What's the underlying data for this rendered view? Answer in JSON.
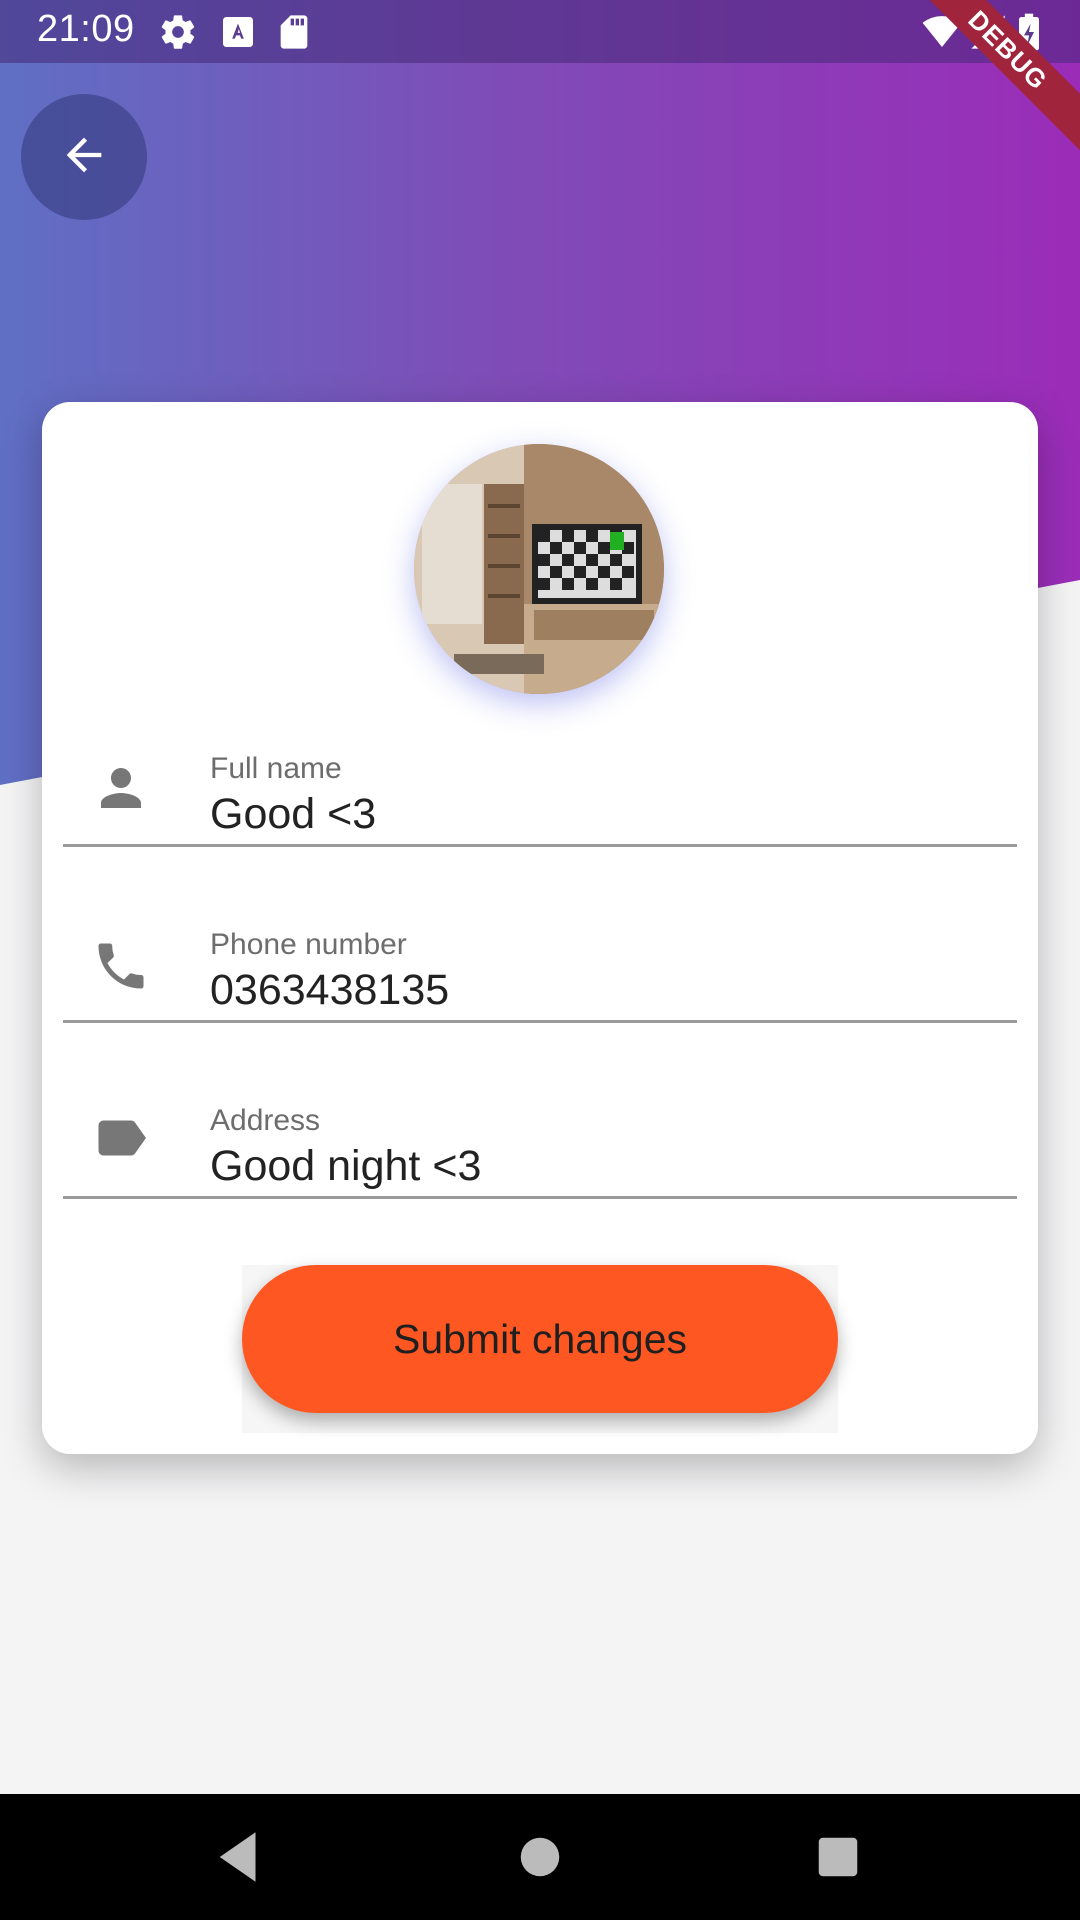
{
  "status_bar": {
    "time": "21:09",
    "left_icons": [
      "settings-icon",
      "a-keyboard-icon",
      "sd-card-icon"
    ],
    "right_icons": [
      "wifi-icon",
      "signal-icon",
      "battery-charging-icon"
    ],
    "debug_label": "DEBUG"
  },
  "header": {
    "back_icon": "arrow-back-icon",
    "gradient_colors": [
      "#5f6fc4",
      "#9b2cb8"
    ]
  },
  "profile": {
    "avatar_description": "avatar image"
  },
  "form": {
    "fields": [
      {
        "icon": "person-icon",
        "label": "Full name",
        "value": "Good <3"
      },
      {
        "icon": "phone-icon",
        "label": "Phone number",
        "value": "0363438135"
      },
      {
        "icon": "label-tag-icon",
        "label": "Address",
        "value": "Good night <3"
      }
    ],
    "submit_label": "Submit changes",
    "accent_color": "#ff5722"
  },
  "nav_bar": {
    "buttons": [
      "back-triangle-icon",
      "home-circle-icon",
      "recents-square-icon"
    ]
  }
}
